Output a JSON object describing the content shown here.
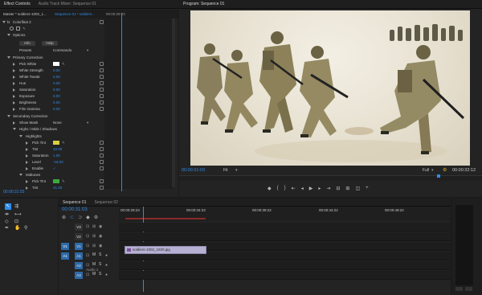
{
  "effect_controls": {
    "tabs": [
      "Effect Controls",
      "Audio Track Mixer: Sequence 01"
    ],
    "master_clip": "Master * soldiers-1002_1...",
    "sequence_clip": "Sequence 01 * soldiers...",
    "mini_time": "00:00:29:23",
    "effect_name": "Colorlfast 2",
    "options_label": "Options",
    "info_btn": "Info",
    "help_btn": "Help",
    "presets_label": "Presets",
    "presets_value": "Commando",
    "primary_label": "Primary Correction",
    "params": [
      {
        "label": "Pick White",
        "value": ""
      },
      {
        "label": "White Strength",
        "value": "0.00"
      },
      {
        "label": "White Tweak",
        "value": "0.00"
      },
      {
        "label": "Hue",
        "value": "0.00"
      },
      {
        "label": "Saturation",
        "value": "0.00"
      },
      {
        "label": "Exposure",
        "value": "0.00"
      },
      {
        "label": "Brightness",
        "value": "0.00"
      },
      {
        "label": "Film Gamma",
        "value": "0.00"
      }
    ],
    "secondary_label": "Secondary Correction",
    "show_mask_label": "Show Mask",
    "show_mask_value": "None",
    "hmc_label": "Highs / Mids / Shadows",
    "highlights_label": "Highlights",
    "hl_params": [
      {
        "label": "Pick Tint",
        "value": ""
      },
      {
        "label": "Tint",
        "value": "33.00"
      },
      {
        "label": "Saturation",
        "value": "1.00"
      },
      {
        "label": "Level",
        "value": "-18.00"
      },
      {
        "label": "Enable",
        "value": "✓"
      }
    ],
    "midtones_label": "Midtones",
    "mid_params": [
      {
        "label": "Pick Tint",
        "value": ""
      },
      {
        "label": "Tint",
        "value": "41.00"
      }
    ],
    "bottom_time": "00:00:31:03"
  },
  "program": {
    "tab": "Program: Sequence 01",
    "timecode": "00:00:31:03",
    "fit": "Fit",
    "quality": "Full",
    "duration": "00:00:32:12"
  },
  "timeline": {
    "tabs": [
      "Sequence 01",
      "Sequence 02"
    ],
    "timecode": "00:00:31:03",
    "ruler": [
      "00:00:29:23",
      "00:00:34:23",
      "00:00:39:22",
      "00:00:44:22",
      "00:00:49:22"
    ],
    "video_tracks": [
      "V3",
      "V2",
      "V1"
    ],
    "audio_tracks": [
      "A1",
      "A2",
      "A3"
    ],
    "source_patch": [
      "V1",
      "A1"
    ],
    "clip_name": "soldiers-1002_1920.jpg",
    "audio_label": "Audio 1",
    "track_mute": "M",
    "track_solo": "S"
  },
  "colors": {
    "accent": "#2d8ceb",
    "playhead": "#2d8ceb",
    "clip": "#b6b0d2",
    "tint_yellow": "#d8d040",
    "tint_green": "#3caa3c"
  }
}
